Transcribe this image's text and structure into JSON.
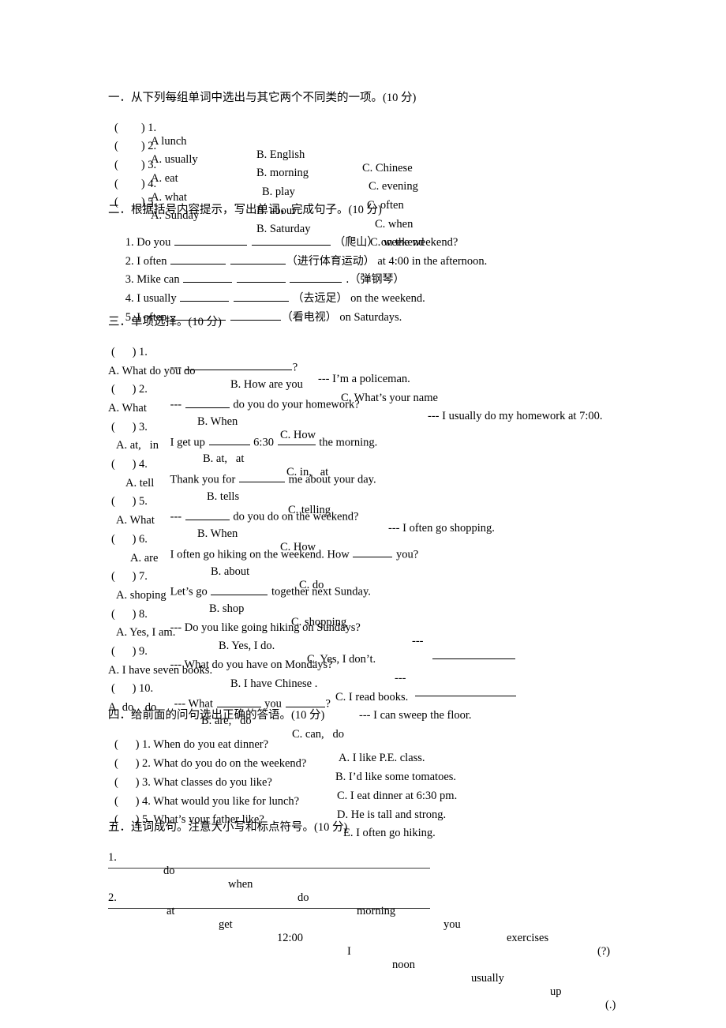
{
  "sections": [
    {
      "id": "section-one",
      "heading": "一．从下列每组单词中选出与其它两个不同类的一项。(10 分)",
      "items": [
        {
          "paren": "(        ) 1.",
          "a": "A lunch",
          "b": "B. English",
          "c": "C. Chinese"
        },
        {
          "paren": "(        ) 2.",
          "a": "A. usually",
          "b": "B. morning",
          "c": "C. evening"
        },
        {
          "paren": "(        ) 3.",
          "a": "A. eat",
          "b": "B. play",
          "c": "C. often"
        },
        {
          "paren": "(        ) 4.",
          "a": "A. what",
          "b": "B. about",
          "c": "C. when"
        },
        {
          "paren": "(        ) 5.",
          "a": "A. Sunday",
          "b": "B. Saturday",
          "c": "C. weekend"
        }
      ]
    },
    {
      "id": "section-two",
      "heading": "二．根据括号内容提示，写出单词，完成句子。(10 分)",
      "items": [
        {
          "pre": "1. Do you ",
          "mid": "（爬山）",
          "post": " on the weekend?"
        },
        {
          "pre": "2. I often ",
          "mid": "（进行体育运动）",
          "post": " at 4:00 in the afternoon."
        },
        {
          "pre": "3. Mike can ",
          "mid": ".（弹钢琴）",
          "post": ""
        },
        {
          "pre": "4. I usually ",
          "mid": "（去远足）",
          "post": " on the weekend."
        },
        {
          "pre": "5. I often ",
          "mid": "（看电视）",
          "post": " on Saturdays."
        }
      ]
    },
    {
      "id": "section-three",
      "heading": "三．单项选择。(10 分)",
      "items": [
        {
          "num": "(      ) 1.",
          "q_pre": " --- ",
          "q_post": "?",
          "answer": "--- I’m a policeman.",
          "options": [
            "A. What do you do",
            "B. How are you",
            "C. What’s your name"
          ]
        },
        {
          "num": "(      ) 2.",
          "q_pre": " --- ",
          "q_post": " do you do your homework?",
          "answer": "--- I usually do my homework at 7:00.",
          "options": [
            "A. What",
            "B. When",
            "C. How"
          ]
        },
        {
          "num": "(      ) 3.",
          "q_pre": " I get up ",
          "q_post": " the morning.",
          "answer": "",
          "options": [
            "A. at,   in",
            "B. at,   at",
            "C. in,   at"
          ]
        },
        {
          "num": "(      ) 4.",
          "q_pre": " Thank you for ",
          "q_post": " me about your day.",
          "answer": "",
          "options": [
            "A. tell",
            "B. tells",
            "C. telling"
          ]
        },
        {
          "num": "(      ) 5.",
          "q_pre": " --- ",
          "q_post": " do you do on the weekend?",
          "answer": "--- I often go shopping.",
          "options": [
            "A. What",
            "B. When",
            "C. How"
          ]
        },
        {
          "num": "(      ) 6.",
          "q_pre": " I often go hiking on the weekend. How ",
          "q_post": " you?",
          "answer": "",
          "options": [
            "A. are",
            "B. about",
            "C. do"
          ]
        },
        {
          "num": "(      ) 7.",
          "q_pre": " Let’s go ",
          "q_post": " together next Sunday.",
          "answer": "",
          "options": [
            "A. shoping",
            "B. shop",
            "C. shopping"
          ]
        },
        {
          "num": "(      ) 8.",
          "q_pre": " --- Do you like going hiking on Sundays?",
          "q_post": "",
          "answer": "---",
          "options": [
            "A. Yes, I am.",
            "B. Yes, I do.",
            "C. Yes, I don’t."
          ]
        },
        {
          "num": "(      ) 9.",
          "q_pre": " --- What do you have on Mondays?",
          "q_post": "",
          "answer": "---",
          "options": [
            "A. I have seven books.",
            "B. I have Chinese .",
            "C. I read books."
          ]
        },
        {
          "num": "(      ) 10.",
          "q_pre": " --- What ",
          "q_post": "?",
          "q_mid": " you ",
          "answer": "--- I can sweep the floor.",
          "options": [
            "A. do,   do",
            "B. are,   do",
            "C. can,   do"
          ]
        }
      ]
    },
    {
      "id": "section-four",
      "heading": "四．给前面的问句选出正确的答语。(10 分)",
      "items": [
        {
          "left": "(      ) 1. When do you eat dinner?",
          "right": "A. I like P.E. class."
        },
        {
          "left": "(      ) 2. What do you do on the weekend?",
          "right": "B. I’d like some tomatoes."
        },
        {
          "left": "(      ) 3. What classes do you like?",
          "right": "C. I eat dinner at 6:30 pm."
        },
        {
          "left": "(      ) 4. What would you like for lunch?",
          "right": "D. He is tall and strong."
        },
        {
          "left": "(      ) 5. What’s your father like?",
          "right": "E. I often go hiking."
        }
      ]
    },
    {
      "id": "section-five",
      "heading": "五．连词成句。注意大小写和标点符号。(10 分)",
      "items": [
        {
          "num": "1.",
          "words": [
            "do",
            "when",
            "do",
            "morning",
            "you",
            "exercises",
            "(?)"
          ]
        },
        {
          "num": "2.",
          "words": [
            "at",
            "get",
            "12:00",
            "I",
            "noon",
            "usually",
            "up",
            "(.)"
          ]
        }
      ]
    }
  ]
}
